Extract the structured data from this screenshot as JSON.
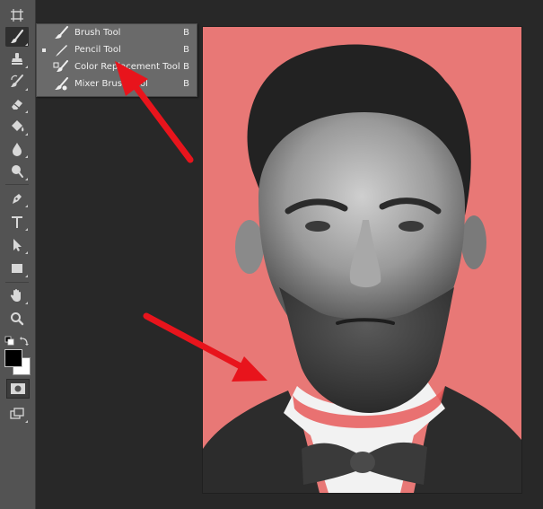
{
  "toolbar": {
    "tools": [
      {
        "name": "artboard-icon"
      },
      {
        "name": "brush-icon",
        "active": true
      },
      {
        "name": "clone-stamp-icon"
      },
      {
        "name": "history-brush-icon"
      },
      {
        "name": "eraser-icon"
      },
      {
        "name": "paint-bucket-icon"
      },
      {
        "name": "blur-icon"
      },
      {
        "name": "dodge-icon"
      },
      {
        "name": "pen-icon"
      },
      {
        "name": "type-icon"
      },
      {
        "name": "path-selection-icon"
      },
      {
        "name": "rectangle-icon"
      },
      {
        "name": "hand-icon"
      },
      {
        "name": "zoom-icon"
      }
    ],
    "foreground_color": "#000000",
    "background_color": "#ffffff"
  },
  "flyout": {
    "items": [
      {
        "label": "Brush Tool",
        "shortcut": "B",
        "icon": "brush-icon",
        "selected": false
      },
      {
        "label": "Pencil Tool",
        "shortcut": "B",
        "icon": "pencil-icon",
        "selected": true
      },
      {
        "label": "Color Replacement Tool",
        "shortcut": "B",
        "icon": "color-replacement-icon",
        "selected": false
      },
      {
        "label": "Mixer Brush Tool",
        "shortcut": "B",
        "icon": "mixer-brush-icon",
        "selected": false
      }
    ]
  },
  "canvas": {
    "mask_overlay_color": "#e87876",
    "image_description_name": "portrait-photo"
  },
  "annotations": {
    "arrow_color": "#e8141c"
  }
}
